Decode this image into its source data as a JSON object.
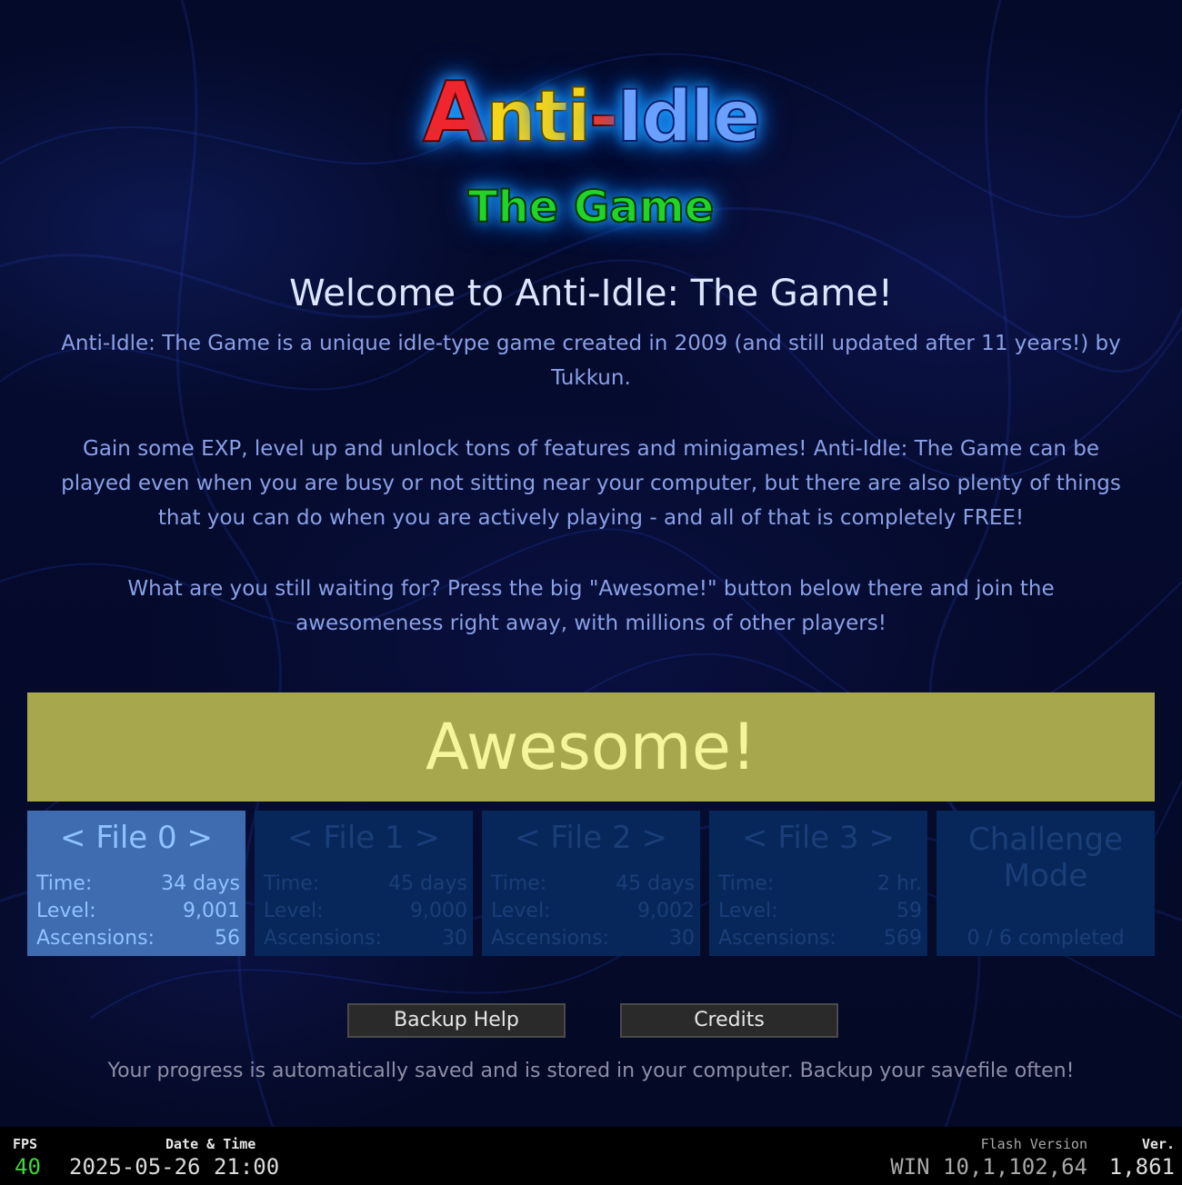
{
  "logo": {
    "line1_a": "A",
    "line1_n": "n",
    "line1_t": "t",
    "line1_i": "i",
    "line1_dash": "-",
    "line1_idle": "Idle",
    "line2": "The Game"
  },
  "welcome": {
    "title": "Welcome to Anti-Idle: The Game!",
    "paragraph1": "Anti-Idle: The Game is a unique idle-type game created in 2009 (and still updated after 11 years!) by Tukkun.",
    "paragraph2": "Gain some EXP, level up and unlock tons of features and minigames! Anti-Idle: The Game can be played even when you are busy or not sitting near your computer, but there are also plenty of things that you can do when you are actively playing - and all of that is completely FREE!",
    "paragraph3": "What are you still waiting for? Press the big \"Awesome!\" button below there and join the awesomeness right away, with millions of other players!"
  },
  "awesome_button": "Awesome!",
  "files": [
    {
      "title": "< File 0 >",
      "time_label": "Time:",
      "time": "34 days",
      "level_label": "Level:",
      "level": "9,001",
      "asc_label": "Ascensions:",
      "ascensions": "56",
      "active": true
    },
    {
      "title": "< File 1 >",
      "time_label": "Time:",
      "time": "45 days",
      "level_label": "Level:",
      "level": "9,000",
      "asc_label": "Ascensions:",
      "ascensions": "30",
      "active": false
    },
    {
      "title": "< File 2 >",
      "time_label": "Time:",
      "time": "45 days",
      "level_label": "Level:",
      "level": "9,002",
      "asc_label": "Ascensions:",
      "ascensions": "30",
      "active": false
    },
    {
      "title": "< File 3 >",
      "time_label": "Time:",
      "time": "2 hr.",
      "level_label": "Level:",
      "level": "59",
      "asc_label": "Ascensions:",
      "ascensions": "569",
      "active": false
    }
  ],
  "challenge": {
    "title": "Challenge Mode",
    "progress": "0 / 6 completed"
  },
  "buttons": {
    "backup_help": "Backup Help",
    "credits": "Credits"
  },
  "save_note": "Your progress is automatically saved and is stored in your computer. Backup your savefile often!",
  "status_bar": {
    "fps_label": "FPS",
    "fps_value": "40",
    "datetime_label": "Date & Time",
    "datetime_value": "2025-05-26 21:00",
    "flash_label": "Flash Version",
    "flash_value": "WIN 10,1,102,64",
    "ver_label": "Ver.",
    "ver_value": "1,861"
  },
  "colors": {
    "background": "#050b2e",
    "awesome_bg": "#a7a74e",
    "awesome_text": "#f5f59a",
    "file_active_bg": "#3f6bb0",
    "file_inactive_bg": "#07275a",
    "fps_green": "#3cd63c"
  }
}
